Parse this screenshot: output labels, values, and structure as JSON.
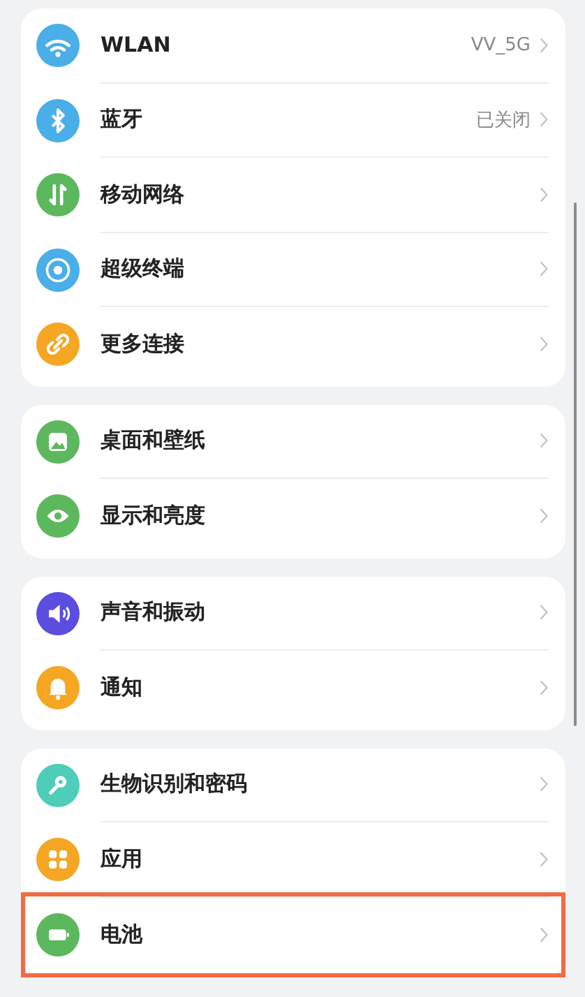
{
  "groups": [
    {
      "items": [
        {
          "label": "WLAN",
          "value": "VV_5G",
          "highlighted": false
        },
        {
          "label": "蓝牙",
          "value": "已关闭",
          "highlighted": false
        },
        {
          "label": "移动网络",
          "highlighted": false
        },
        {
          "label": "超级终端",
          "highlighted": false
        },
        {
          "label": "更多连接",
          "highlighted": false
        }
      ]
    },
    {
      "items": [
        {
          "label": "桌面和壁纸",
          "highlighted": false
        },
        {
          "label": "显示和亮度",
          "highlighted": false
        }
      ]
    },
    {
      "items": [
        {
          "label": "声音和振动",
          "highlighted": false
        },
        {
          "label": "通知",
          "highlighted": false
        }
      ]
    },
    {
      "items": [
        {
          "label": "生物识别和密码",
          "highlighted": false
        },
        {
          "label": "应用",
          "highlighted": false
        },
        {
          "label": "电池",
          "highlighted": true
        }
      ]
    }
  ]
}
